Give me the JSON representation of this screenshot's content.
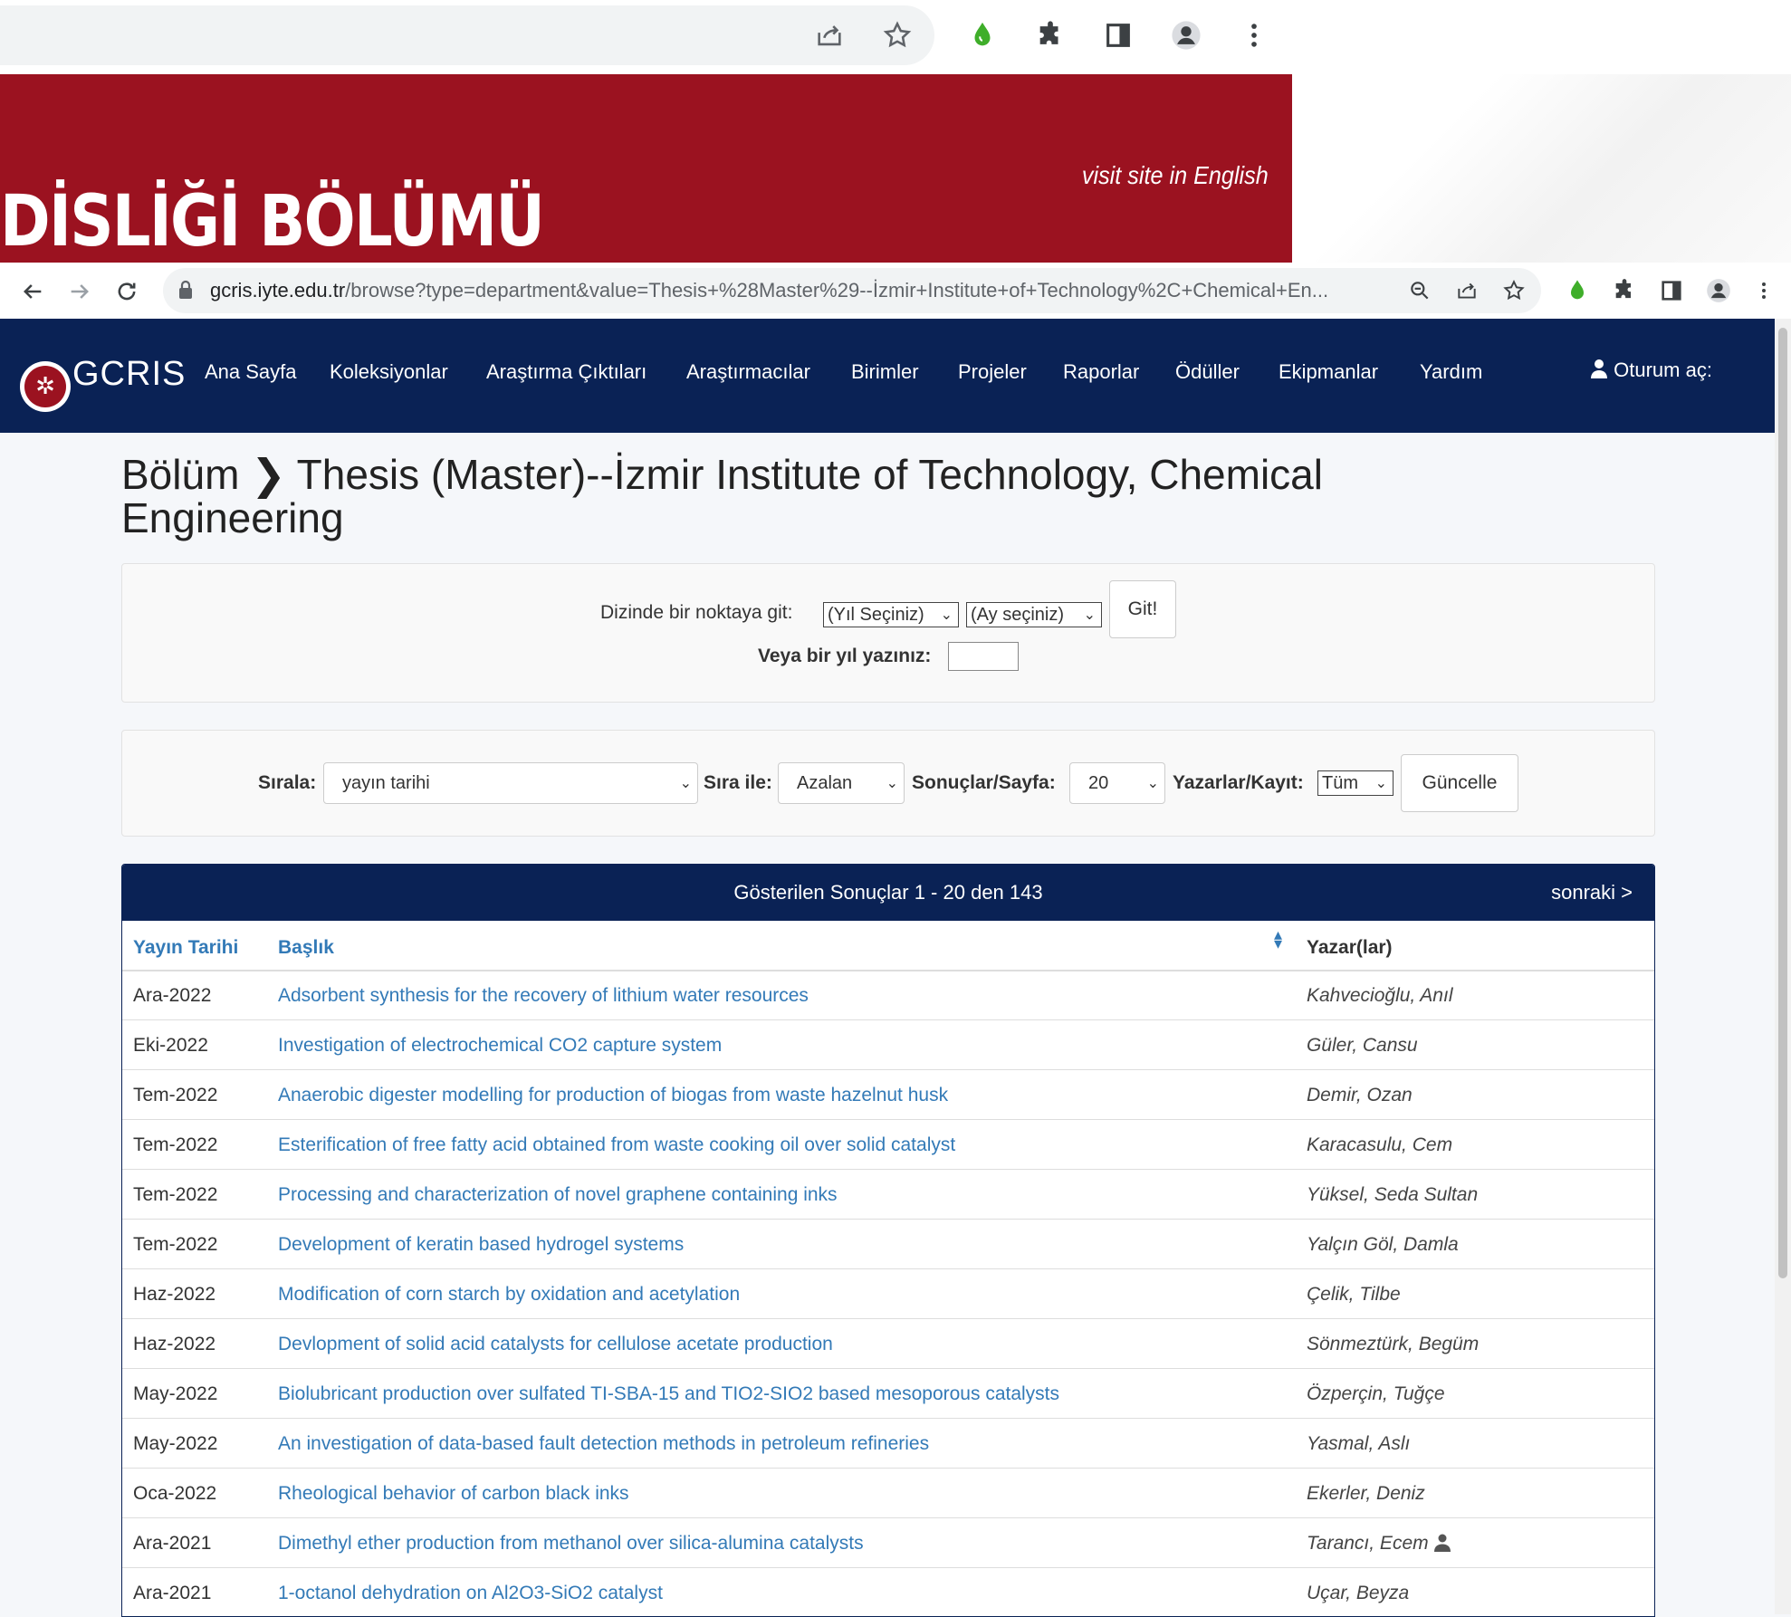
{
  "banner": {
    "title": "DİSLİĞİ BÖLÜMÜ",
    "english_link": "visit site in English"
  },
  "browser": {
    "url_host": "gcris.iyte.edu.tr",
    "url_path": "/browse?type=department&value=Thesis+%28Master%29--İzmir+Institute+of+Technology%2C+Chemical+En..."
  },
  "nav": {
    "logo": "GCRIS",
    "items": [
      "Ana Sayfa",
      "Koleksiyonlar",
      "Araştırma Çıktıları",
      "Araştırmacılar",
      "Birimler",
      "Projeler",
      "Raporlar",
      "Ödüller",
      "Ekipmanlar",
      "Yardım"
    ],
    "login": "Oturum aç:"
  },
  "page": {
    "title": "Bölüm ❯ Thesis (Master)--İzmir Institute of Technology, Chemical Engineering"
  },
  "jump": {
    "label": "Dizinde bir noktaya git:",
    "year_select": "(Yıl Seçiniz)",
    "month_select": "(Ay seçiniz)",
    "go": "Git!",
    "year_label": "Veya bir yıl yazınız:",
    "year_value": ""
  },
  "sort": {
    "sort_label": "Sırala:",
    "sort_value": "yayın tarihi",
    "order_label": "Sıra ile:",
    "order_value": "Azalan",
    "rpp_label": "Sonuçlar/Sayfa:",
    "rpp_value": "20",
    "authors_label": "Yazarlar/Kayıt:",
    "authors_value": "Tüm",
    "update": "Güncelle"
  },
  "results": {
    "info": "Gösterilen Sonuçlar 1 - 20 den 143",
    "next": "sonraki >",
    "columns": {
      "date": "Yayın Tarihi",
      "title": "Başlık",
      "authors": "Yazar(lar)"
    },
    "rows": [
      {
        "date": "Ara-2022",
        "title": "Adsorbent synthesis for the recovery of lithium water resources",
        "author": "Kahvecioğlu, Anıl"
      },
      {
        "date": "Eki-2022",
        "title": "Investigation of electrochemical CO2 capture system",
        "author": "Güler, Cansu"
      },
      {
        "date": "Tem-2022",
        "title": "Anaerobic digester modelling for production of biogas from waste hazelnut husk",
        "author": "Demir, Ozan"
      },
      {
        "date": "Tem-2022",
        "title": "Esterification of free fatty acid obtained from waste cooking oil over solid catalyst",
        "author": "Karacasulu, Cem"
      },
      {
        "date": "Tem-2022",
        "title": "Processing and characterization of novel graphene containing inks",
        "author": "Yüksel, Seda Sultan"
      },
      {
        "date": "Tem-2022",
        "title": "Development of keratin based hydrogel systems",
        "author": "Yalçın Göl, Damla"
      },
      {
        "date": "Haz-2022",
        "title": "Modification of corn starch by oxidation and acetylation",
        "author": "Çelik, Tilbe"
      },
      {
        "date": "Haz-2022",
        "title": "Devlopment of solid acid catalysts for cellulose acetate production",
        "author": "Sönmeztürk, Begüm"
      },
      {
        "date": "May-2022",
        "title": "Biolubricant production over sulfated TI-SBA-15 and TIO2-SIO2 based mesoporous catalysts",
        "author": "Özperçin, Tuğçe"
      },
      {
        "date": "May-2022",
        "title": "An investigation of data-based fault detection methods in petroleum refineries",
        "author": "Yasmal, Aslı"
      },
      {
        "date": "Oca-2022",
        "title": "Rheological behavior of carbon black inks",
        "author": "Ekerler, Deniz"
      },
      {
        "date": "Ara-2021",
        "title": "Dimethyl ether production from methanol over silica-alumina catalysts",
        "author": "Tarancı, Ecem"
      },
      {
        "date": "Ara-2021",
        "title": "1-octanol dehydration on Al2O3-SiO2 catalyst",
        "author": "Uçar, Beyza"
      }
    ]
  }
}
